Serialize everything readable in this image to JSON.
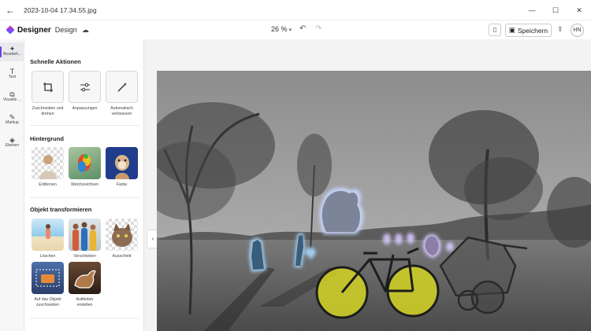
{
  "window": {
    "title": "2023-10-04 17.34.55.jpg",
    "back_icon": "arrow-left-icon",
    "controls": [
      "minimize-icon",
      "maximize-icon",
      "close-icon"
    ]
  },
  "appbar": {
    "app_name": "Designer",
    "mode": "Design",
    "zoom": "26 %",
    "save_label": "Speichern",
    "avatar_initials": "HN"
  },
  "rail": {
    "items": [
      {
        "label": "Bearbeit...",
        "icon": "sparkle-icon"
      },
      {
        "label": "Text",
        "icon": "text-icon"
      },
      {
        "label": "Visuelle ...",
        "icon": "shapes-icon"
      },
      {
        "label": "Markup",
        "icon": "pen-icon"
      },
      {
        "label": "Ebenen",
        "icon": "layers-icon"
      }
    ]
  },
  "panel": {
    "quick_actions": {
      "title": "Schnelle Aktionen",
      "items": [
        {
          "label": "Zuschneiden und drehen",
          "icon": "crop-icon"
        },
        {
          "label": "Anpassungen",
          "icon": "sliders-icon"
        },
        {
          "label": "Automatisch verbessern",
          "icon": "magic-wand-icon"
        }
      ]
    },
    "background": {
      "title": "Hintergrund",
      "items": [
        {
          "label": "Entfernen"
        },
        {
          "label": "Weichzeichnen"
        },
        {
          "label": "Farbe"
        }
      ]
    },
    "transform": {
      "title": "Objekt transformieren",
      "items": [
        {
          "label": "Löschen"
        },
        {
          "label": "Verschieben"
        },
        {
          "label": "Ausschnitt"
        },
        {
          "label": "Auf das Objekt zuschneiden"
        },
        {
          "label": "Aufkleber erstellen"
        }
      ]
    }
  },
  "colors": {
    "accent": "#6a43d8",
    "glow": "#7fb8ff",
    "highlight": "#e8e81a"
  }
}
